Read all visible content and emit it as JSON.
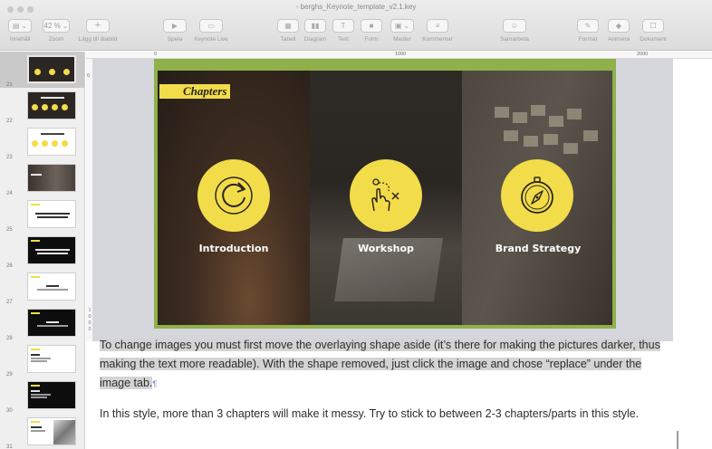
{
  "window": {
    "title": "berghs_Keynote_template_v2.1.key"
  },
  "toolbar": {
    "view_label": "Innehåll",
    "zoom_value": "42 %",
    "zoom_label": "Zoom",
    "add_slide_label": "Lägg till diabild",
    "play_label": "Spela",
    "keynote_live_label": "Keynote Live",
    "table_label": "Tabell",
    "chart_label": "Diagram",
    "text_label": "Text",
    "shape_label": "Form",
    "media_label": "Medier",
    "comment_label": "Kommentar",
    "collaborate_label": "Samarbeta",
    "format_label": "Format",
    "animate_label": "Animera",
    "document_label": "Dokument"
  },
  "navigator": {
    "slides": [
      {
        "number": "21",
        "style": "dark",
        "selected": true
      },
      {
        "number": "22",
        "style": "dark"
      },
      {
        "number": "23",
        "style": "light"
      },
      {
        "number": "24",
        "style": "photo"
      },
      {
        "number": "25",
        "style": "light"
      },
      {
        "number": "26",
        "style": "black"
      },
      {
        "number": "27",
        "style": "light"
      },
      {
        "number": "28",
        "style": "black"
      },
      {
        "number": "29",
        "style": "light"
      },
      {
        "number": "30",
        "style": "black"
      },
      {
        "number": "31",
        "style": "light"
      }
    ]
  },
  "rulers": {
    "h_marks": [
      "0",
      "1000",
      "2000"
    ],
    "v_marks": [
      "0",
      "1",
      "0",
      "0",
      "0"
    ]
  },
  "slide": {
    "tag": "Chapters",
    "chapters": [
      {
        "label": "Introduction",
        "icon": "refresh-arrow-icon"
      },
      {
        "label": "Workshop",
        "icon": "hand-pointer-icon"
      },
      {
        "label": "Brand Strategy",
        "icon": "compass-icon"
      }
    ],
    "accent_color": "#f2dc4a",
    "frame_color": "#8fb04a"
  },
  "notes": {
    "paragraph1": "To change images you must first move the overlaying shape aside (it’s there for making the pictures darker, thus making the text more readable). With the shape removed, just click the image and chose “replace” under the image tab.",
    "paragraph2": "In this style, more than 3 chapters will make it messy. Try to stick to between 2-3 chapters/parts in this style."
  }
}
